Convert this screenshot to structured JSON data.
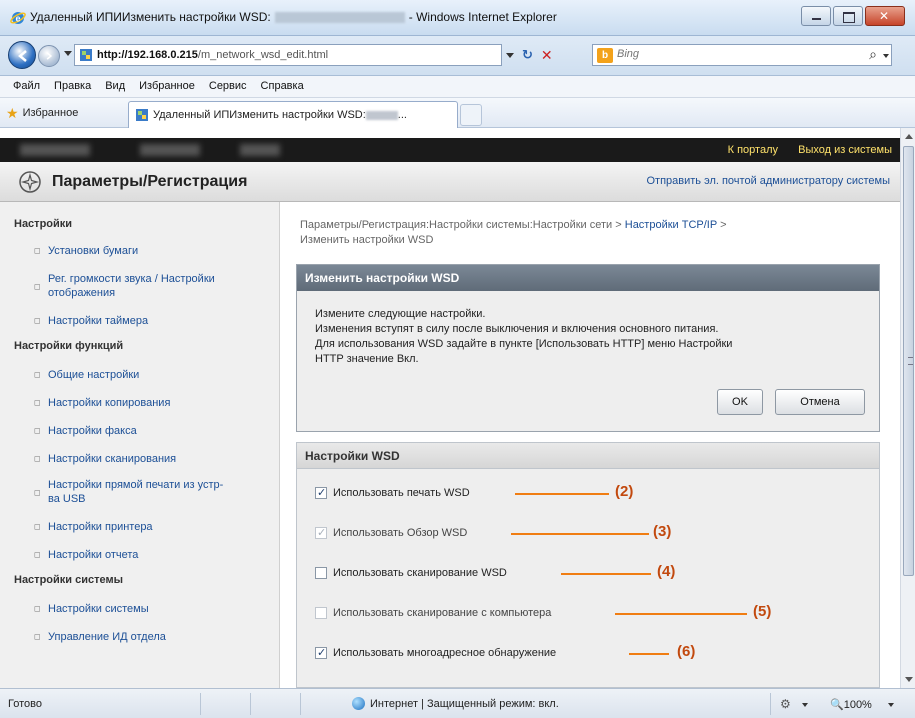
{
  "window": {
    "title_prefix": "Удаленный ИПИИзменить настройки WSD:",
    "title_suffix": "- Windows Internet Explorer"
  },
  "address": {
    "url_host": "http://192.168.0.215",
    "url_path": "/m_network_wsd_edit.html",
    "search_placeholder": "Bing",
    "search_logo": "b"
  },
  "menu": [
    "Файл",
    "Правка",
    "Вид",
    "Избранное",
    "Сервис",
    "Справка"
  ],
  "favorites": {
    "label": "Избранное",
    "tab_title": "Удаленный ИПИзменить настройки WSD:"
  },
  "topbar": {
    "portal": "К порталу",
    "logout": "Выход из системы"
  },
  "header": {
    "title": "Параметры/Регистрация",
    "mail_link": "Отправить эл. почтой администратору системы"
  },
  "sidebar": {
    "sections": [
      {
        "title": "Настройки",
        "items": [
          "Установки бумаги",
          "Рег. громкости звука / Настройки отображения",
          "Настройки таймера"
        ]
      },
      {
        "title": "Настройки функций",
        "items": [
          "Общие настройки",
          "Настройки копирования",
          "Настройки факса",
          "Настройки сканирования",
          "Настройки прямой печати из устр-ва USB",
          "Настройки принтера",
          "Настройки отчета"
        ]
      },
      {
        "title": "Настройки системы",
        "items": [
          "Настройки системы",
          "Управление ИД отдела"
        ]
      }
    ]
  },
  "breadcrumb": {
    "part1": "Параметры/Регистрация:Настройки системы:Настройки сети",
    "part2": "Настройки TCP/IP",
    "part3": "Изменить настройки WSD",
    "sep": ">"
  },
  "edit_panel": {
    "title": "Изменить настройки WSD",
    "line1": "Измените следующие настройки.",
    "line2": "Изменения вступят в силу после выключения и включения основного питания.",
    "line3": "Для использования WSD задайте в пункте [Использовать HTTP] меню Настройки",
    "line4": "HTTP значение Вкл.",
    "ok": "OK",
    "cancel": "Отмена"
  },
  "wsd_panel": {
    "title": "Настройки WSD",
    "options": [
      {
        "label": "Использовать печать WSD",
        "checked": true,
        "disabled": false,
        "callout": "(2)"
      },
      {
        "label": "Использовать Обзор WSD",
        "checked": true,
        "disabled": true,
        "callout": "(3)"
      },
      {
        "label": "Использовать сканирование WSD",
        "checked": false,
        "disabled": false,
        "callout": "(4)"
      },
      {
        "label": "Использовать сканирование с компьютера",
        "checked": false,
        "disabled": true,
        "callout": "(5)"
      },
      {
        "label": "Использовать многоадресное обнаружение",
        "checked": true,
        "disabled": false,
        "callout": "(6)"
      }
    ]
  },
  "status": {
    "text": "Готово",
    "zone": "Интернет | Защищенный режим: вкл.",
    "zoom": "100%"
  },
  "colors": {
    "accent_link": "#1c4f96",
    "callout": "#c2490e",
    "leader": "#f07d12"
  }
}
